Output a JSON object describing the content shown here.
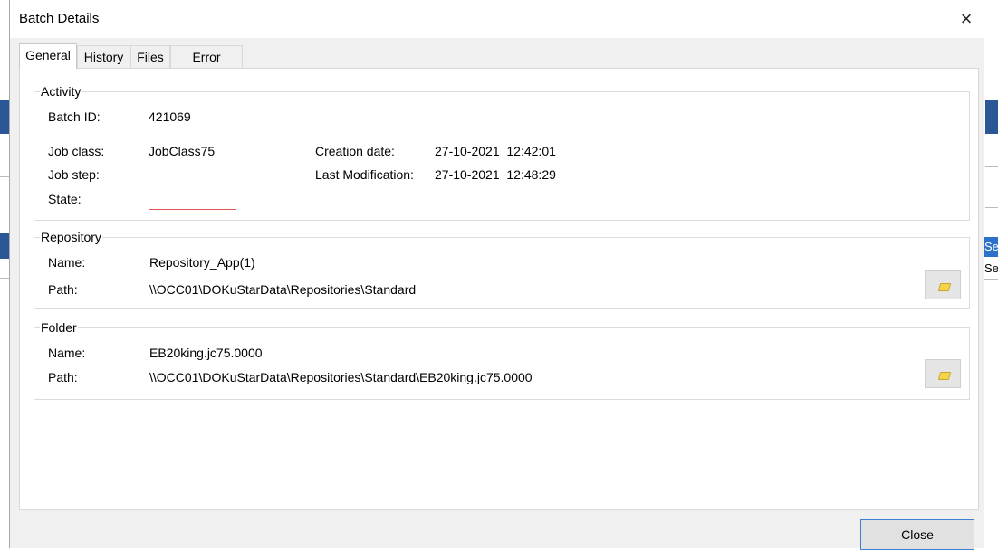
{
  "dialog": {
    "title": "Batch Details",
    "close_glyph": "×"
  },
  "tabs": [
    {
      "label": "General",
      "active": true
    },
    {
      "label": "History",
      "active": false
    },
    {
      "label": "Files",
      "active": false
    },
    {
      "label": "Error",
      "active": false
    }
  ],
  "activity": {
    "group_title": "Activity",
    "batch_id_label": "Batch ID:",
    "batch_id_value": "421069",
    "job_class_label": "Job class:",
    "job_class_value": "JobClass75",
    "job_step_label": "Job step:",
    "job_step_value": "",
    "state_label": "State:",
    "state_value": "",
    "creation_date_label": "Creation date:",
    "creation_date_value": "27-10-2021  12:42:01",
    "last_modification_label": "Last Modification:",
    "last_modification_value": "27-10-2021  12:48:29"
  },
  "repository": {
    "group_title": "Repository",
    "name_label": "Name:",
    "name_value": "Repository_App(1)",
    "path_label": "Path:",
    "path_value": "\\\\OCC01\\DOKuStarData\\Repositories\\Standard"
  },
  "folder": {
    "group_title": "Folder",
    "name_label": "Name:",
    "name_value": "EB20king.jc75.0000",
    "path_label": "Path:",
    "path_value": "\\\\OCC01\\DOKuStarData\\Repositories\\Standard\\EB20king.jc75.0000"
  },
  "footer": {
    "close_label": "Close"
  },
  "background": {
    "right_selected_text": "Se",
    "right_text": "Se"
  },
  "icons": {
    "browse": "folder-icon",
    "close": "close-icon"
  },
  "colors": {
    "dialog_bg": "#f0f0f0",
    "panel_bg": "#ffffff",
    "selection_blue": "#2b72c8",
    "button_border": "#3c7fd4",
    "state_underline": "#e05555"
  }
}
